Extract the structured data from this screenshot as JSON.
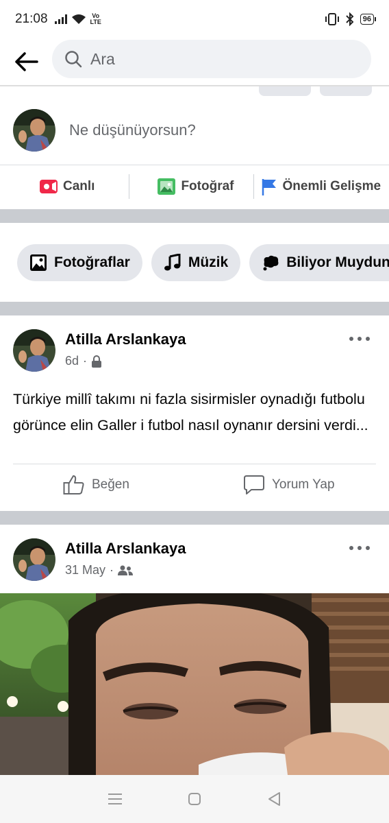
{
  "status_bar": {
    "time": "21:08",
    "network_label": "Vo\nLTE",
    "battery": "96"
  },
  "search": {
    "placeholder": "Ara"
  },
  "composer": {
    "prompt": "Ne düşünüyorsun?"
  },
  "actions": [
    {
      "label": "Canlı",
      "icon": "live-video-icon",
      "color": "#f02849"
    },
    {
      "label": "Fotoğraf",
      "icon": "photo-icon",
      "color": "#45bd62"
    },
    {
      "label": "Önemli Gelişme",
      "icon": "flag-icon",
      "color": "#3578e5"
    }
  ],
  "chips": [
    {
      "label": "Fotoğraflar",
      "icon": "photos-icon"
    },
    {
      "label": "Müzik",
      "icon": "music-note-icon"
    },
    {
      "label": "Biliyor Muydunuz",
      "icon": "speech-bubble-icon"
    }
  ],
  "posts": [
    {
      "author": "Atilla Arslankaya",
      "time": "6d",
      "privacy_icon": "lock-icon",
      "text": "Türkiye millî takımı ni fazla sisirmisler oynadığı futbolu görünce elin Galler i futbol nasıl oynanır dersini verdi...",
      "like_label": "Beğen",
      "comment_label": "Yorum Yap"
    },
    {
      "author": "Atilla Arslankaya",
      "time": "31 May",
      "privacy_icon": "friends-icon"
    }
  ],
  "colors": {
    "separator": "#c9ccd1",
    "chip_bg": "#e4e6eb",
    "search_bg": "#f0f2f5",
    "secondary_text": "#65676b"
  }
}
